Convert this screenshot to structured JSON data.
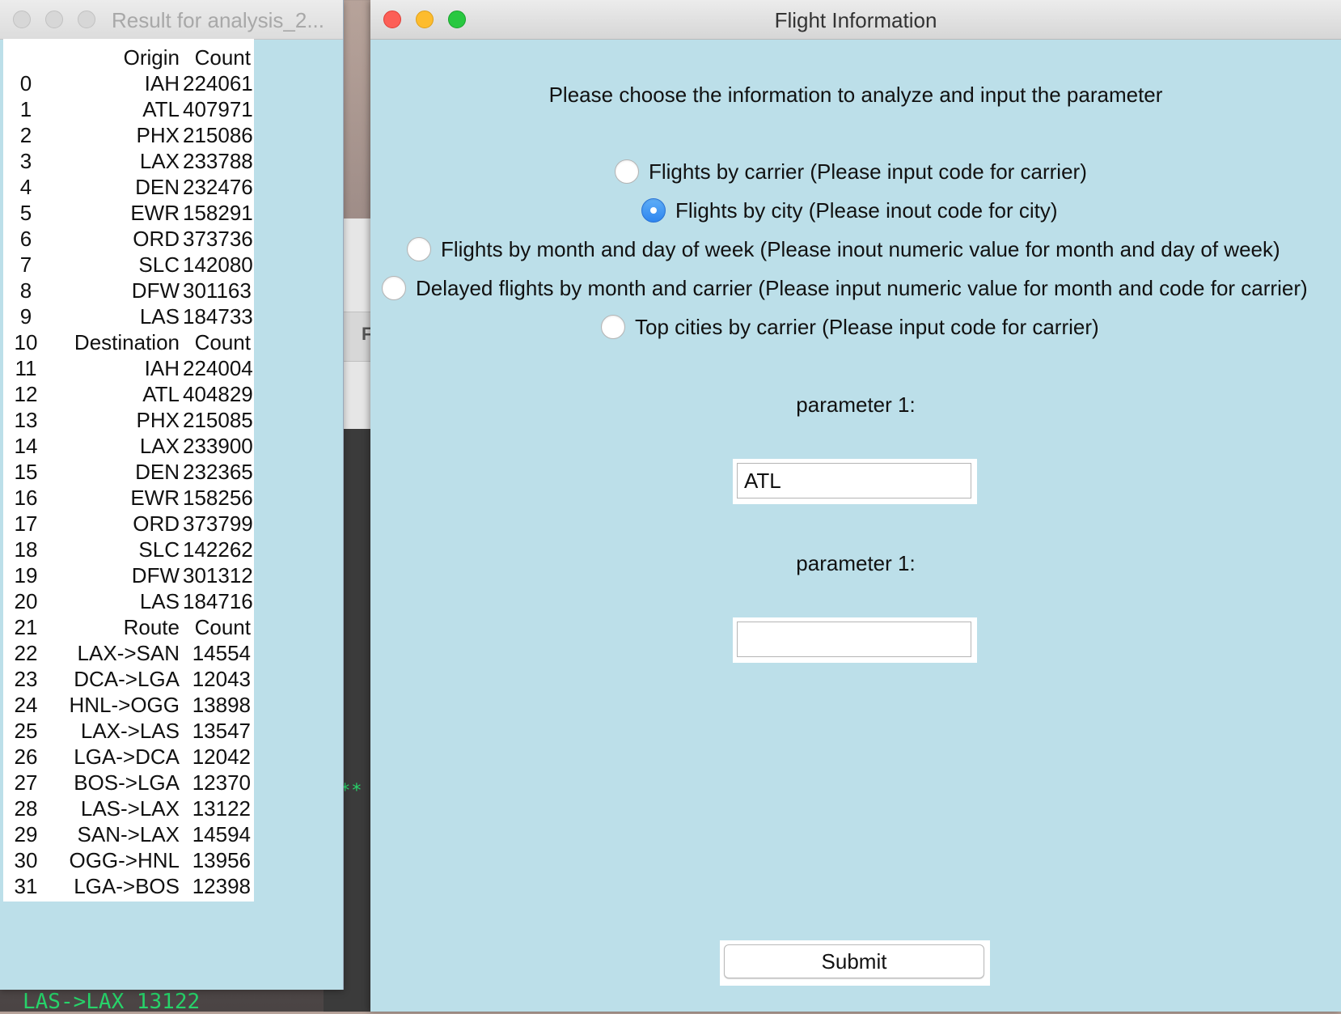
{
  "background": {
    "stars": "**",
    "green_line": "LAS->LAX  13122",
    "grey_letter": "F"
  },
  "result_window": {
    "title": "Result for analysis_2...",
    "rows": [
      {
        "idx": "",
        "key": "Origin",
        "val": "Count"
      },
      {
        "idx": "0",
        "key": "IAH",
        "val": "224061"
      },
      {
        "idx": "1",
        "key": "ATL",
        "val": "407971"
      },
      {
        "idx": "2",
        "key": "PHX",
        "val": "215086"
      },
      {
        "idx": "3",
        "key": "LAX",
        "val": "233788"
      },
      {
        "idx": "4",
        "key": "DEN",
        "val": "232476"
      },
      {
        "idx": "5",
        "key": "EWR",
        "val": "158291"
      },
      {
        "idx": "6",
        "key": "ORD",
        "val": "373736"
      },
      {
        "idx": "7",
        "key": "SLC",
        "val": "142080"
      },
      {
        "idx": "8",
        "key": "DFW",
        "val": "301163"
      },
      {
        "idx": "9",
        "key": "LAS",
        "val": "184733"
      },
      {
        "idx": "10",
        "key": "Destination",
        "val": "Count"
      },
      {
        "idx": "11",
        "key": "IAH",
        "val": "224004"
      },
      {
        "idx": "12",
        "key": "ATL",
        "val": "404829"
      },
      {
        "idx": "13",
        "key": "PHX",
        "val": "215085"
      },
      {
        "idx": "14",
        "key": "LAX",
        "val": "233900"
      },
      {
        "idx": "15",
        "key": "DEN",
        "val": "232365"
      },
      {
        "idx": "16",
        "key": "EWR",
        "val": "158256"
      },
      {
        "idx": "17",
        "key": "ORD",
        "val": "373799"
      },
      {
        "idx": "18",
        "key": "SLC",
        "val": "142262"
      },
      {
        "idx": "19",
        "key": "DFW",
        "val": "301312"
      },
      {
        "idx": "20",
        "key": "LAS",
        "val": "184716"
      },
      {
        "idx": "21",
        "key": "Route",
        "val": "Count"
      },
      {
        "idx": "22",
        "key": "LAX->SAN",
        "val": "14554"
      },
      {
        "idx": "23",
        "key": "DCA->LGA",
        "val": "12043"
      },
      {
        "idx": "24",
        "key": "HNL->OGG",
        "val": "13898"
      },
      {
        "idx": "25",
        "key": "LAX->LAS",
        "val": "13547"
      },
      {
        "idx": "26",
        "key": "LGA->DCA",
        "val": "12042"
      },
      {
        "idx": "27",
        "key": "BOS->LGA",
        "val": "12370"
      },
      {
        "idx": "28",
        "key": "LAS->LAX",
        "val": "13122"
      },
      {
        "idx": "29",
        "key": "SAN->LAX",
        "val": "14594"
      },
      {
        "idx": "30",
        "key": "OGG->HNL",
        "val": "13956"
      },
      {
        "idx": "31",
        "key": "LGA->BOS",
        "val": "12398"
      }
    ]
  },
  "flight_window": {
    "title": "Flight Information",
    "instruction": "Please choose the information to analyze and input the parameter",
    "options": [
      {
        "label": "Flights by carrier (Please input code for carrier)",
        "checked": false
      },
      {
        "label": "Flights by city (Please inout code for city)",
        "checked": true
      },
      {
        "label": "Flights by month and day of week (Please inout numeric value for month and day of week)",
        "checked": false
      },
      {
        "label": "Delayed flights by month and carrier (Please input numeric value for month and code for carrier)",
        "checked": false
      },
      {
        "label": "Top cities by carrier (Please input code for carrier)",
        "checked": false
      }
    ],
    "param1_label": "parameter 1:",
    "param1_value": "ATL",
    "param2_label": "parameter 1:",
    "param2_value": "",
    "submit_label": "Submit"
  }
}
